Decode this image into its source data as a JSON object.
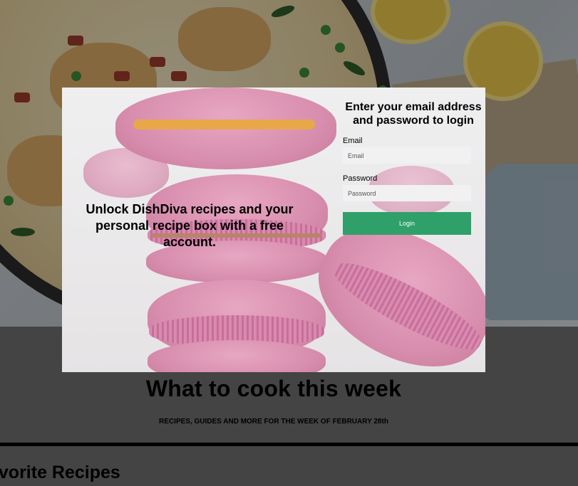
{
  "page": {
    "section_title": "What to cook this week",
    "section_subtitle": "RECIPES, GUIDES AND MORE FOR THE WEEK OF FEBRUARY 28th",
    "favorites_title": "avorite Recipes"
  },
  "hero_image": {
    "alt": "creamy chicken with bacon, peas and spinach"
  },
  "modal": {
    "background_image": {
      "alt": "pink macarons"
    },
    "tagline": "Unlock DishDiva recipes and your personal recipe box with a free account.",
    "login_heading": "Enter your email address and password to login",
    "email": {
      "label": "Email",
      "placeholder": "Email",
      "value": ""
    },
    "password": {
      "label": "Password",
      "placeholder": "Password",
      "value": ""
    },
    "login_button": "Login"
  },
  "colors": {
    "overlay": "#000000",
    "login_button": "#2fa06a",
    "input_background": "#f1f1f1",
    "page_background": "#6e6e6e"
  }
}
